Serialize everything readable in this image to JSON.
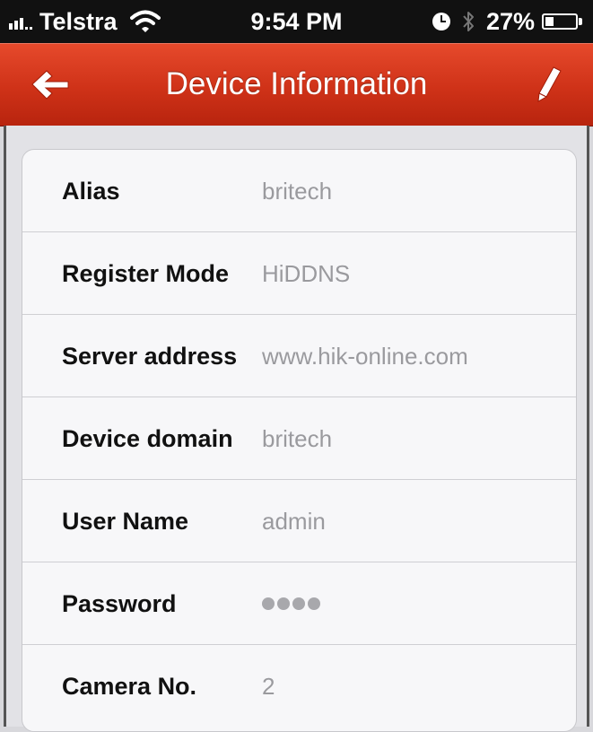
{
  "status_bar": {
    "carrier": "Telstra",
    "time": "9:54 PM",
    "battery_percent": "27%",
    "battery_level": 0.27,
    "icons": [
      "signal-icon",
      "wifi-icon",
      "alarm-clock-icon",
      "bluetooth-icon",
      "battery-icon"
    ]
  },
  "nav": {
    "title": "Device Information",
    "back_icon": "arrow-left-icon",
    "edit_icon": "pencil-icon",
    "bar_color": "#cf3218"
  },
  "fields": [
    {
      "label": "Alias",
      "value": "britech"
    },
    {
      "label": "Register Mode",
      "value": "HiDDNS"
    },
    {
      "label": "Server address",
      "value": "www.hik-online.com"
    },
    {
      "label": "Device domain",
      "value": "britech"
    },
    {
      "label": "User Name",
      "value": "admin"
    },
    {
      "label": "Password",
      "value": "●●●●",
      "masked": true
    },
    {
      "label": "Camera No.",
      "value": "2"
    }
  ]
}
